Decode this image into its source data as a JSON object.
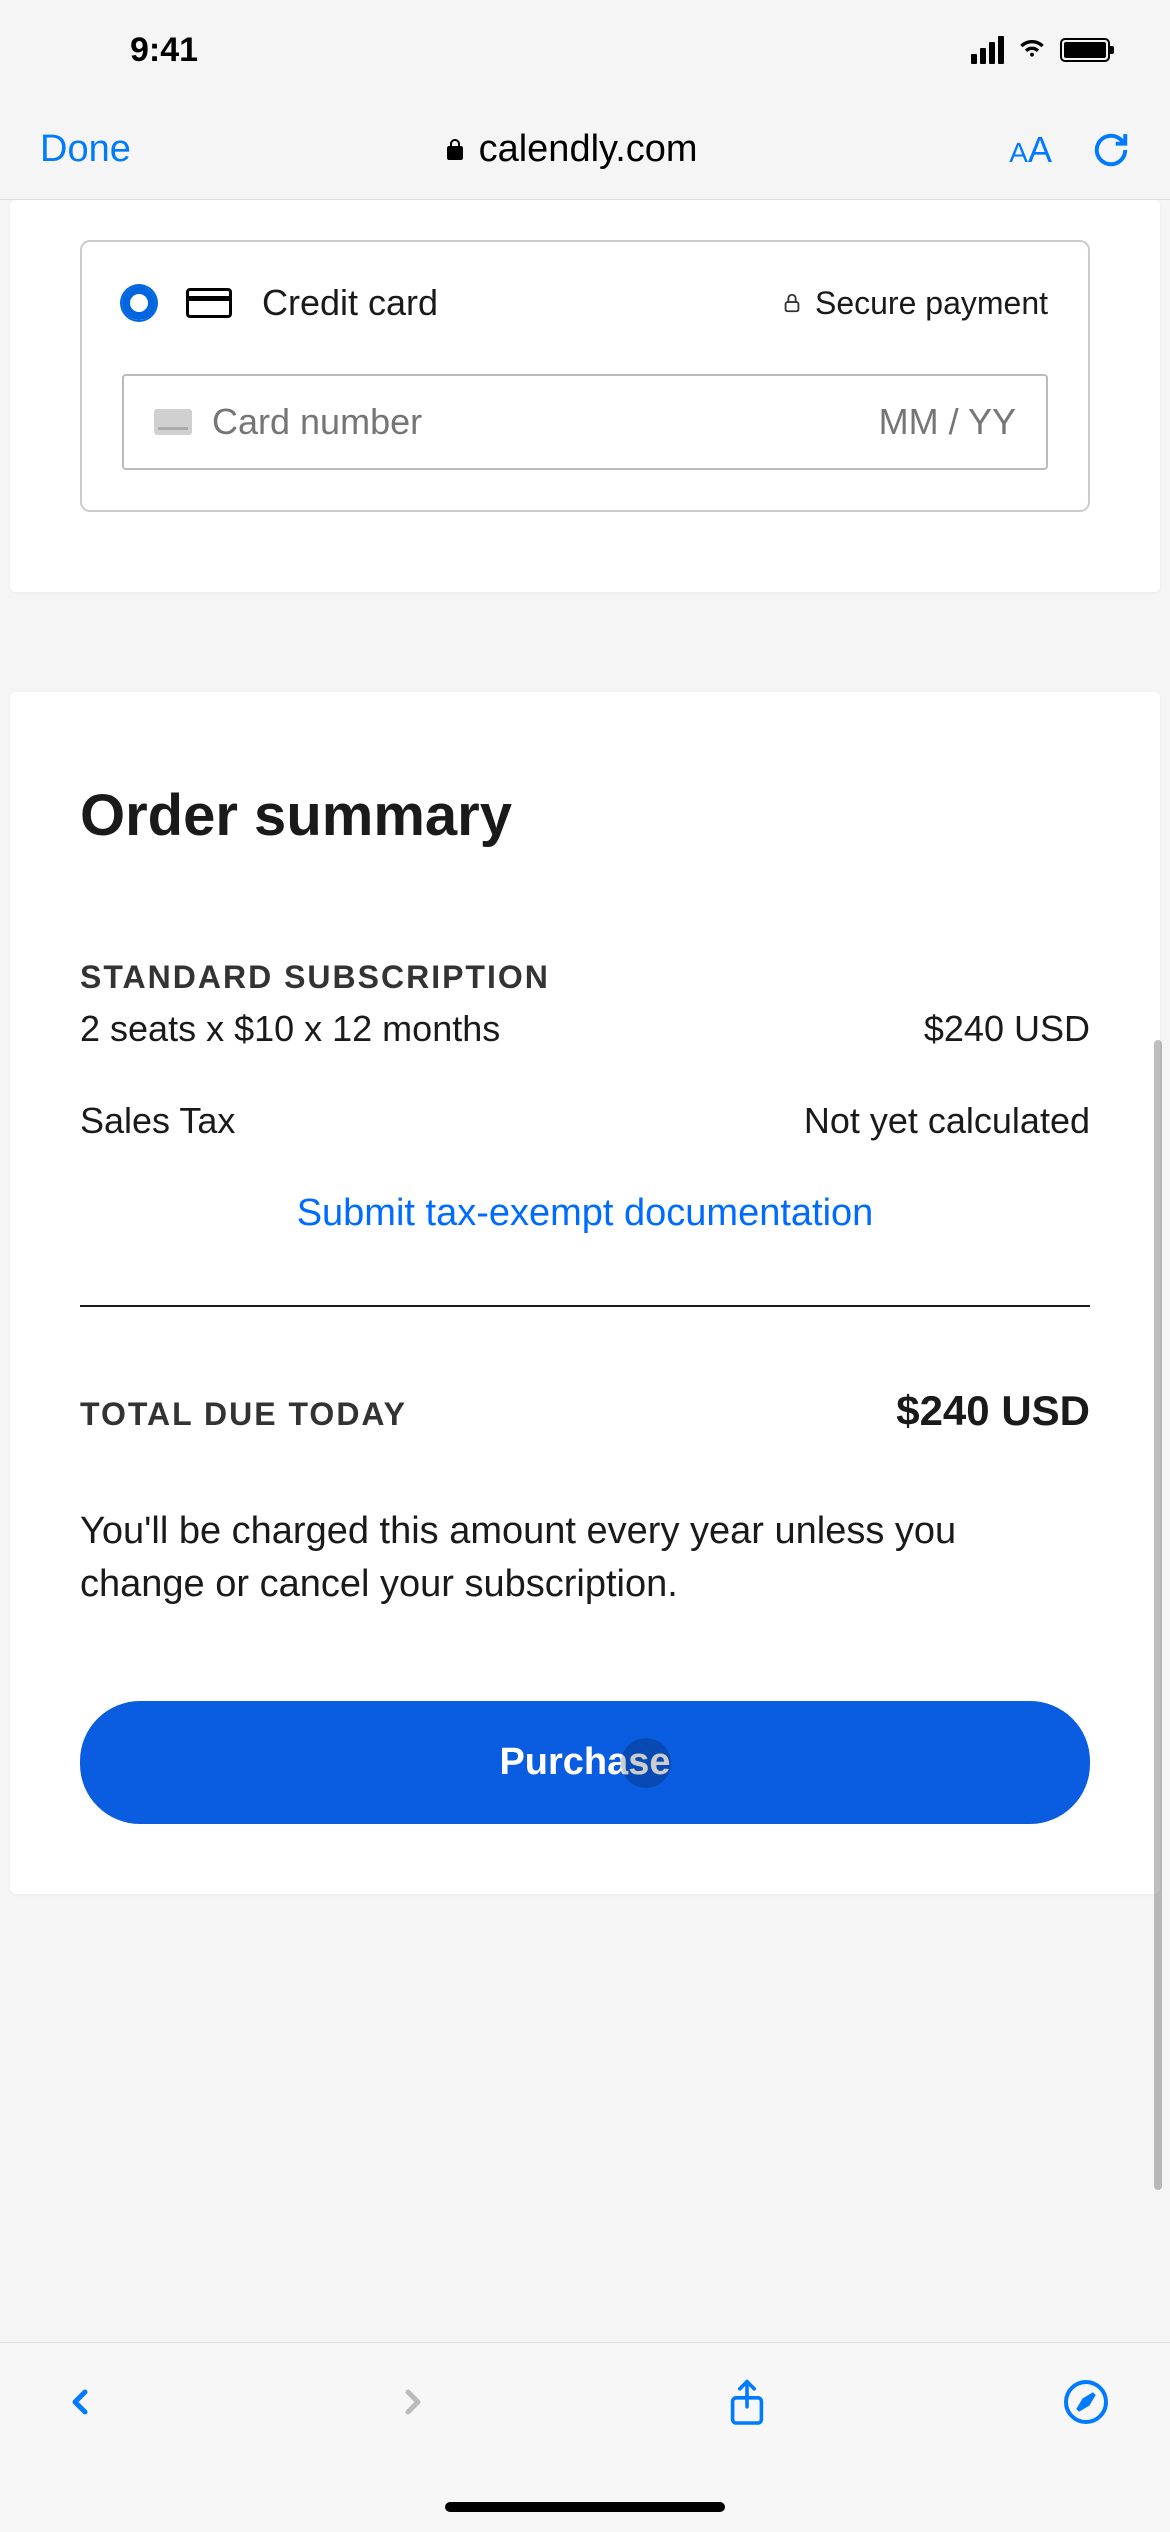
{
  "status_bar": {
    "time": "9:41"
  },
  "browser": {
    "done_label": "Done",
    "url": "calendly.com"
  },
  "payment": {
    "method_label": "Credit card",
    "secure_label": "Secure payment",
    "card_placeholder": "Card number",
    "expiry_placeholder": "MM / YY"
  },
  "summary": {
    "title": "Order summary",
    "subscription_label": "STANDARD SUBSCRIPTION",
    "seats_detail": "2 seats x $10 x 12 months",
    "seats_amount": "$240 USD",
    "tax_label": "Sales Tax",
    "tax_value": "Not yet calculated",
    "tax_exempt_link": "Submit tax-exempt documentation",
    "total_label": "TOTAL DUE TODAY",
    "total_value": "$240 USD",
    "charge_note": "You'll be charged this amount every year unless you change or cancel your subscription.",
    "purchase_button": "Purchase"
  }
}
